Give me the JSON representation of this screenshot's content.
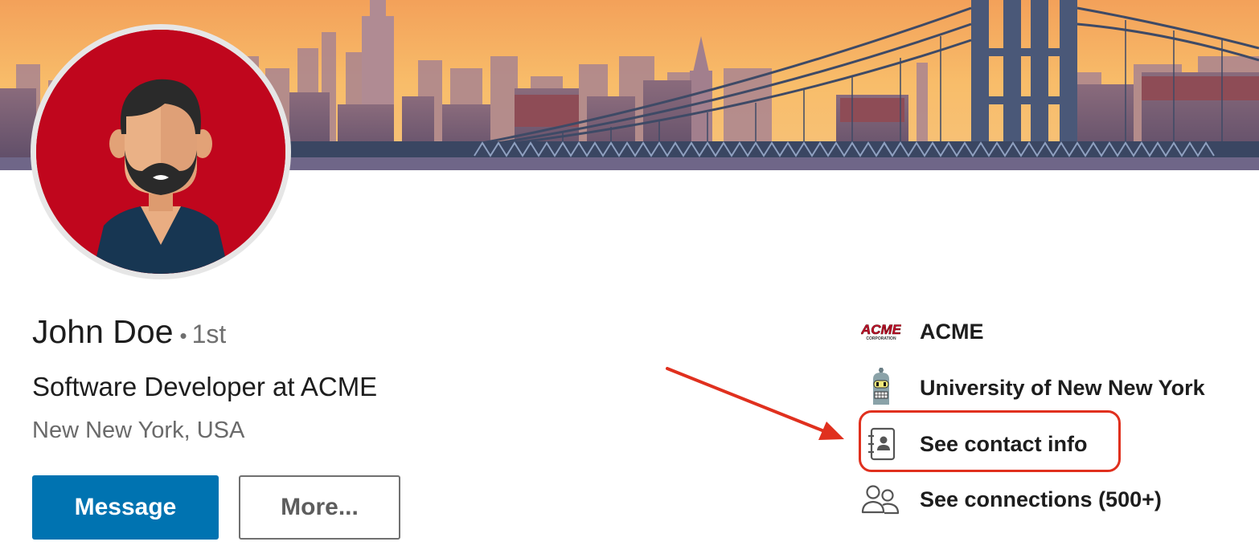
{
  "profile": {
    "name": "John Doe",
    "degree": "1st",
    "degree_separator": "•",
    "headline": "Software Developer at ACME",
    "location": "New New York, USA"
  },
  "actions": {
    "message_label": "Message",
    "more_label": "More..."
  },
  "sidebar": {
    "items": [
      {
        "label": "ACME",
        "icon": "acme-logo-icon",
        "logo_text": "ACME",
        "logo_subtext": "CORPORATION"
      },
      {
        "label": "University of New New York",
        "icon": "robot-logo-icon"
      },
      {
        "label": "See contact info",
        "icon": "contact-book-icon"
      },
      {
        "label": "See connections (500+)",
        "icon": "people-icon"
      }
    ]
  },
  "colors": {
    "primary_button": "#0073b1",
    "avatar_background": "#c0061d",
    "annotation": "#e0301e",
    "banner_sky": "#f6b863"
  }
}
